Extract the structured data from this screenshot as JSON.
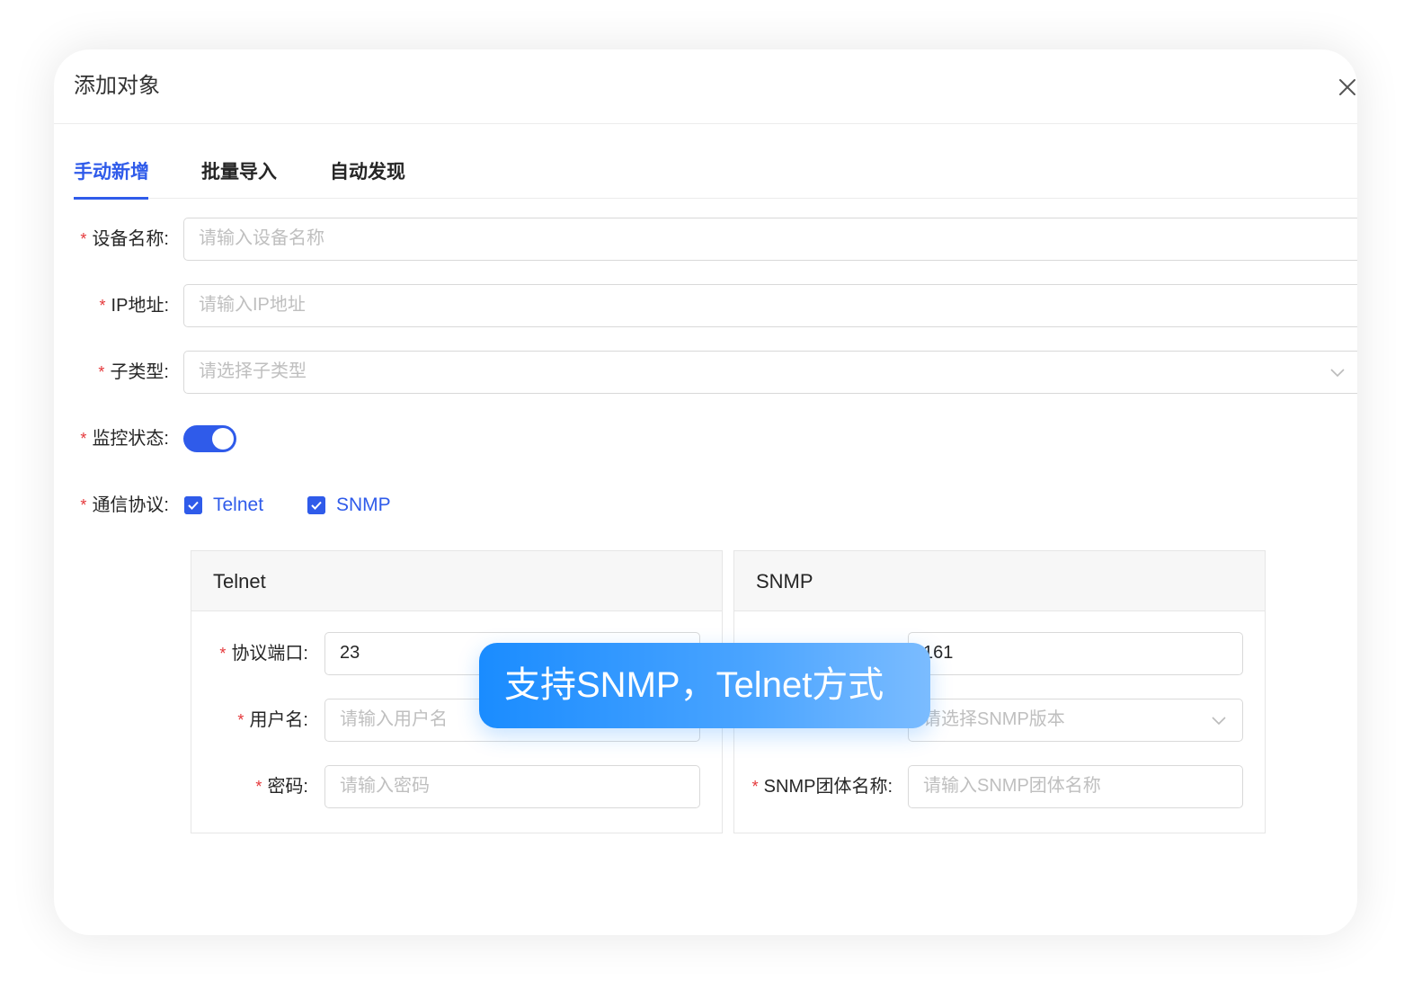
{
  "dialog": {
    "title": "添加对象",
    "close_icon": "close-icon"
  },
  "tabs": [
    {
      "label": "手动新增",
      "active": true
    },
    {
      "label": "批量导入",
      "active": false
    },
    {
      "label": "自动发现",
      "active": false
    }
  ],
  "form": {
    "required_mark": "*",
    "device_name": {
      "label": "设备名称:",
      "placeholder": "请输入设备名称",
      "value": ""
    },
    "ip_address": {
      "label": "IP地址:",
      "placeholder": "请输入IP地址",
      "value": ""
    },
    "subtype": {
      "label": "子类型:",
      "placeholder": "请选择子类型",
      "value": ""
    },
    "monitor_status": {
      "label": "监控状态:",
      "enabled": true
    },
    "protocols": {
      "label": "通信协议:",
      "options": [
        {
          "label": "Telnet",
          "checked": true
        },
        {
          "label": "SNMP",
          "checked": true
        }
      ]
    }
  },
  "telnet_card": {
    "title": "Telnet",
    "port": {
      "label": "协议端口:",
      "value": "23"
    },
    "username": {
      "label": "用户名:",
      "placeholder": "请输入用户名"
    },
    "password": {
      "label": "密码:",
      "placeholder": "请输入密码"
    }
  },
  "snmp_card": {
    "title": "SNMP",
    "port": {
      "value": "161"
    },
    "version": {
      "placeholder": "请选择SNMP版本"
    },
    "community": {
      "label": "SNMP团体名称:",
      "placeholder": "请输入SNMP团体名称"
    }
  },
  "banner": {
    "text": "支持SNMP，Telnet方式"
  },
  "colors": {
    "accent": "#2f5bea",
    "required": "#e5383b",
    "border": "#d9d9d9",
    "placeholder": "#bfbfbf",
    "banner_start": "#1a8cff",
    "banner_end": "#7bbcff"
  }
}
